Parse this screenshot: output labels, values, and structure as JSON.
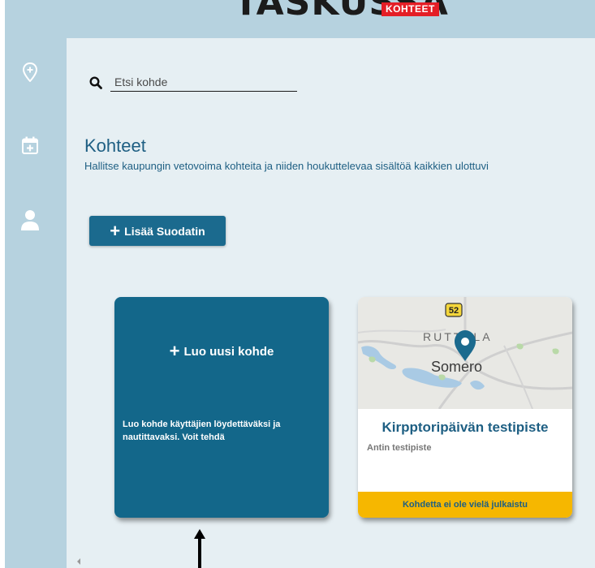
{
  "logo": {
    "text": "TASKUSSA",
    "badge": "KOHTEET"
  },
  "sidebar": {
    "items": [
      {
        "icon": "map-pin-plus-icon"
      },
      {
        "icon": "calendar-plus-icon"
      },
      {
        "icon": "user-icon"
      }
    ]
  },
  "search": {
    "placeholder": "Etsi kohde",
    "value": "",
    "icon": "search-icon"
  },
  "page": {
    "title": "Kohteet",
    "subtitle": "Hallitse kaupungin vetovoima kohteita ja niiden houkuttelevaa sisältöä kaikkien ulottuvi"
  },
  "filter_button": {
    "label": "Lisää Suodatin"
  },
  "new_card": {
    "title": "Luo uusi kohde",
    "description": "Luo kohde käyttäjien löydettäväksi ja nautittavaksi. Voit tehdä"
  },
  "destination_card": {
    "map": {
      "road_number": "52",
      "place_labels": [
        "RUTTULA",
        "Somero"
      ]
    },
    "title": "Kirpptoripäivän testipiste",
    "subtitle": "Antin testipiste",
    "status": "Kohdetta ei ole vielä julkaistu"
  },
  "colors": {
    "sidebar": "#b6d2df",
    "content_bg": "#e6eff3",
    "primary": "#1b6a8e",
    "card_new": "#13678a",
    "title_text": "#1e5f83",
    "status_bar": "#f6b700",
    "logo_badge": "#e41e26"
  }
}
